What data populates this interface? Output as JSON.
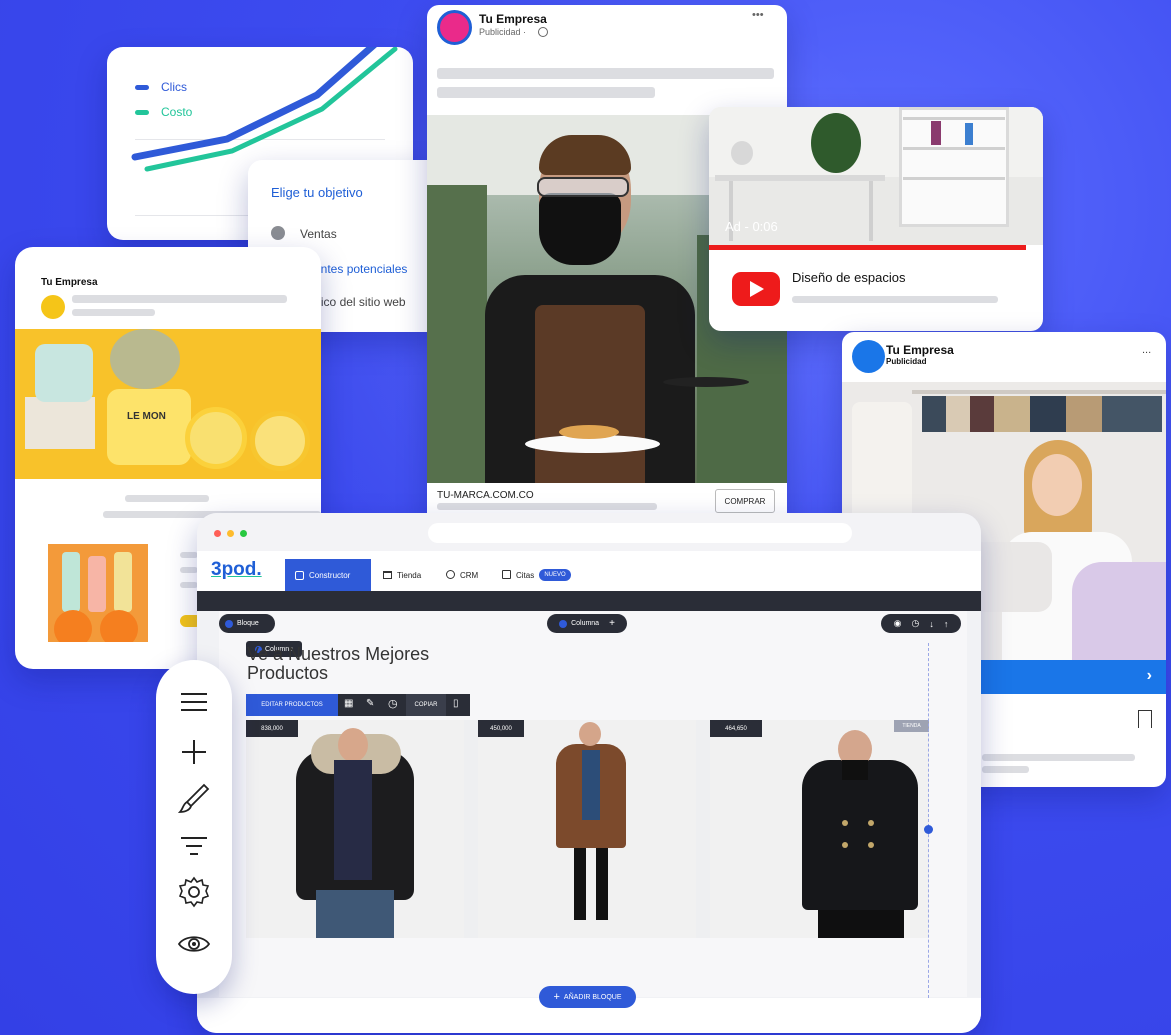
{
  "chart_card": {
    "legend": [
      {
        "label": "Clics",
        "color": "#2f5ad8"
      },
      {
        "label": "Costo",
        "color": "#22c59a"
      }
    ]
  },
  "objective_card": {
    "title": "Elige tu objetivo",
    "options": [
      "Ventas",
      "Clientes potenciales",
      "Tráfico del sitio web"
    ]
  },
  "cosmetics_card": {
    "brand": "Tu Empresa",
    "jar_label": "LE MON"
  },
  "waiter_card": {
    "brand": "Tu Empresa",
    "sub": "Publicidad · ",
    "more": "•••",
    "url": "TU-MARCA.COM.CO",
    "cta": "COMPRAR"
  },
  "youtube_card": {
    "ad_overlay": "Ad - 0:06",
    "title": "Diseño de espacios"
  },
  "seam_card": {
    "brand": "Tu Empresa",
    "sub": "Publicidad",
    "more": "..."
  },
  "builder": {
    "logo": "3pod.",
    "nav": [
      {
        "label": "Constructor",
        "active": true
      },
      {
        "label": "Tienda",
        "active": false
      },
      {
        "label": "CRM",
        "active": false
      },
      {
        "label": "Citas",
        "active": false
      }
    ],
    "nav_badge": "NUEVO",
    "block_pill": "Bloque",
    "column_pill": "Columna",
    "column_tag": "Columna",
    "heading_line1": "Ve a Nuestros Mejores",
    "heading_line2": "Productos",
    "edit_products": "EDITAR PRODUCTOS",
    "copy_label": "COPIAR",
    "prices": [
      "838,000",
      "450,000",
      "464,650"
    ],
    "corner_tag": "TIENDA",
    "add_block": "AÑADIR BLOQUE"
  },
  "tools": [
    "menu-icon",
    "plus-icon",
    "brush-icon",
    "filter-icon",
    "settings-icon",
    "eye-icon"
  ]
}
